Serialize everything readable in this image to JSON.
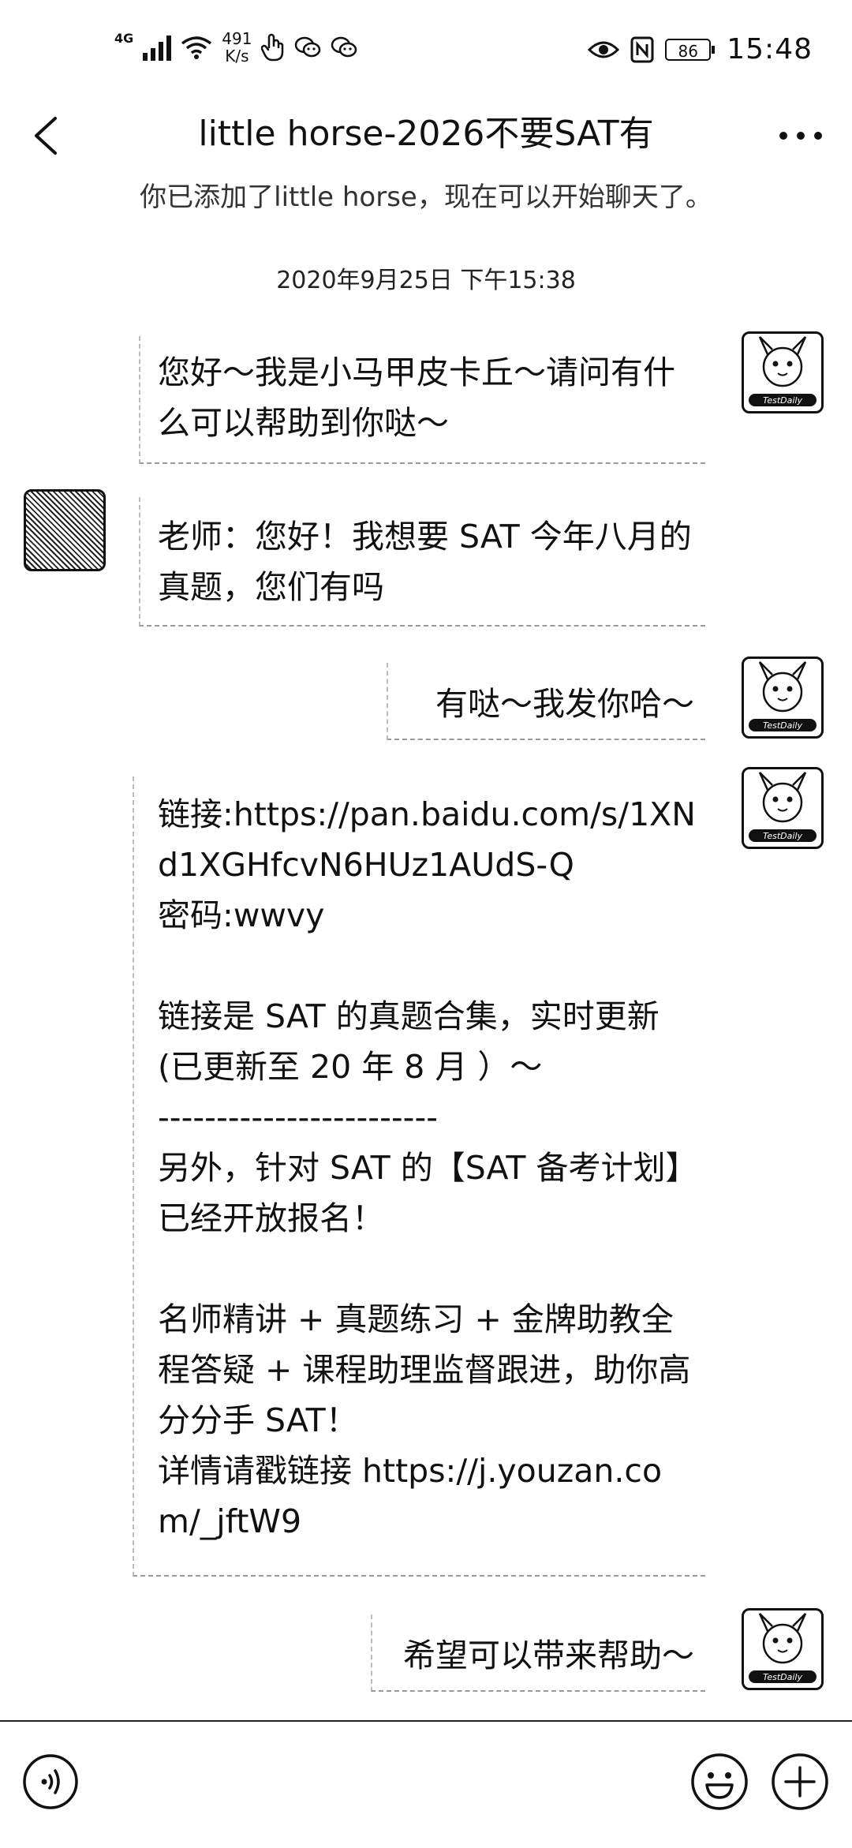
{
  "status_bar": {
    "network": "4G",
    "speed_value": "491",
    "speed_unit": "K/s",
    "battery": "86",
    "time": "15:48",
    "icons": [
      "signal-icon",
      "wifi-icon",
      "hand-icon",
      "chat-app-icon",
      "chat-app-icon",
      "eye-icon",
      "nfc-icon",
      "battery-icon"
    ]
  },
  "header": {
    "title": "little horse-2026不要SAT有",
    "icons": [
      "back-arrow-icon",
      "more-options-icon"
    ]
  },
  "chat": {
    "system_notice": "你已添加了little horse，现在可以开始聊天了。",
    "timestamp": "2020年9月25日 下午15:38",
    "messages": [
      {
        "sender": "other",
        "text": "您好～我是小马甲皮卡丘～请问有什么可以帮助到你哒～"
      },
      {
        "sender": "me",
        "text": "老师：您好！我想要 SAT 今年八月的真题，您们有吗"
      },
      {
        "sender": "other",
        "text": "有哒～我发你哈～"
      },
      {
        "sender": "other",
        "text": "链接:https://pan.baidu.com/s/1XNd1XGHfcvN6HUz1AUdS-Q\n密码:wwvy\n\n链接是 SAT 的真题合集，实时更新(已更新至 20 年 8 月 ）～\n------------------------\n另外，针对 SAT 的【SAT 备考计划】已经开放报名！\n\n名师精讲 + 真题练习 + 金牌助教全程答疑 + 课程助理监督跟进，助你高分分手 SAT！\n详情请戳链接 https://j.youzan.com/_jftW9"
      },
      {
        "sender": "other",
        "text": "希望可以带来帮助～"
      }
    ],
    "avatar_badge": "TestDaily"
  },
  "input_bar": {
    "icons": [
      "voice-icon",
      "emoji-icon",
      "plus-icon"
    ]
  }
}
